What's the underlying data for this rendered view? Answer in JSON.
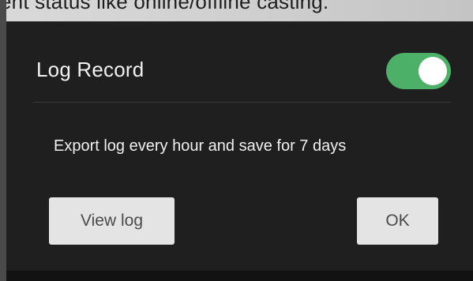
{
  "backdrop": {
    "text": "ent status like online/offline casting."
  },
  "dialog": {
    "title": "Log Record",
    "toggle_state": "on",
    "description": "Export log every hour and save for 7 days",
    "buttons": {
      "view_log_label": "View log",
      "ok_label": "OK"
    }
  },
  "colors": {
    "dialog_background": "#1f1f1f",
    "toggle_on": "#4cb068",
    "button_background": "#e4e4e4",
    "button_text": "#4a4a4a",
    "text_primary": "#f2f2f2"
  }
}
